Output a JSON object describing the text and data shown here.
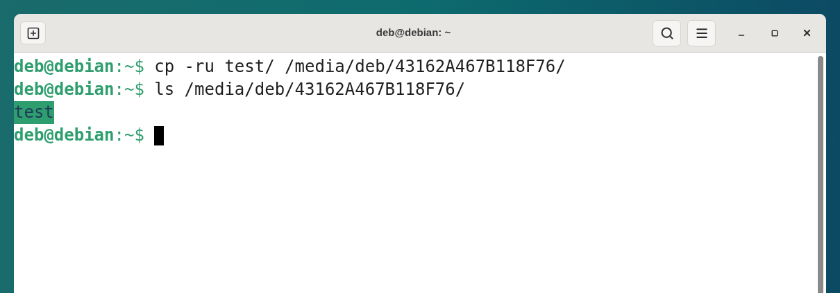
{
  "window": {
    "title": "deb@debian: ~"
  },
  "terminal": {
    "lines": [
      {
        "kind": "prompt",
        "user_host": "deb@debian",
        "path": ":~$",
        "command": "cp -ru test/ /media/deb/43162A467B118F76/",
        "cursor": false
      },
      {
        "kind": "prompt",
        "user_host": "deb@debian",
        "path": ":~$",
        "command": "ls /media/deb/43162A467B118F76/",
        "cursor": false
      },
      {
        "kind": "output",
        "entries": [
          {
            "text": "test",
            "highlighted": true
          }
        ]
      },
      {
        "kind": "prompt",
        "user_host": "deb@debian",
        "path": ":~$",
        "cursor": true
      }
    ]
  }
}
